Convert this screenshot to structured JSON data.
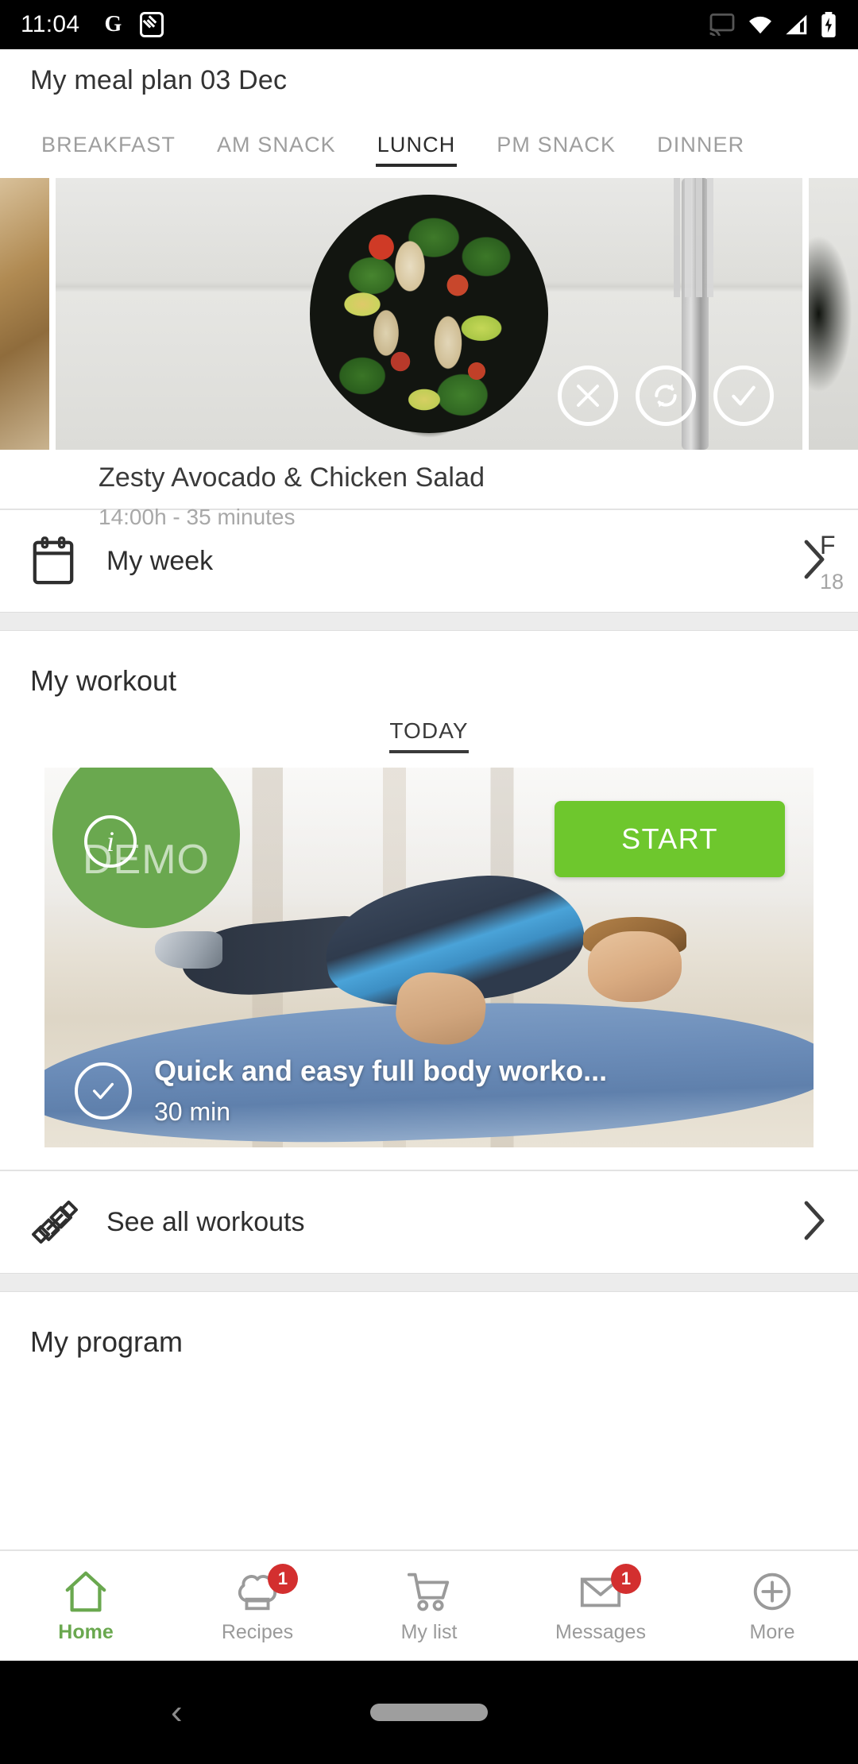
{
  "status_bar": {
    "time": "11:04",
    "left_icons": [
      "google-icon",
      "screenshot-edit-icon"
    ],
    "right_icons": [
      "cast-icon",
      "wifi-icon",
      "signal-icon",
      "battery-charging-icon"
    ]
  },
  "app_bar": {
    "title": "My meal plan 03 Dec"
  },
  "meal_tabs": {
    "items": [
      {
        "label": "BREAKFAST",
        "active": false
      },
      {
        "label": "AM SNACK",
        "active": false
      },
      {
        "label": "LUNCH",
        "active": true
      },
      {
        "label": "PM SNACK",
        "active": false
      },
      {
        "label": "DINNER",
        "active": false
      }
    ]
  },
  "meal_card": {
    "title": "Zesty Avocado & Chicken Salad",
    "subtitle": "14:00h - 35 minutes",
    "actions": [
      {
        "name": "dismiss-meal-button",
        "icon": "close-icon"
      },
      {
        "name": "swap-meal-button",
        "icon": "refresh-icon"
      },
      {
        "name": "accept-meal-button",
        "icon": "check-icon"
      }
    ],
    "next_card_peek": {
      "title": "F",
      "subtitle": "18"
    }
  },
  "my_week_row": {
    "label": "My week",
    "icon": "calendar-icon",
    "chevron": "chevron-right-icon"
  },
  "workout_section": {
    "title": "My workout",
    "today_tab": "TODAY",
    "card": {
      "demo_badge": "DEMO",
      "info_icon": "info-icon",
      "start_button": "START",
      "title": "Quick and easy full body worko...",
      "duration": "30 min",
      "completed_icon": "check-circle-icon"
    }
  },
  "see_all_workouts_row": {
    "label": "See all workouts",
    "icon": "dumbbell-icon",
    "chevron": "chevron-right-icon"
  },
  "program_section": {
    "title": "My program"
  },
  "bottom_nav": {
    "items": [
      {
        "label": "Home",
        "icon": "home-icon",
        "active": true,
        "badge": ""
      },
      {
        "label": "Recipes",
        "icon": "chef-hat-icon",
        "active": false,
        "badge": "1"
      },
      {
        "label": "My list",
        "icon": "cart-icon",
        "active": false,
        "badge": ""
      },
      {
        "label": "Messages",
        "icon": "envelope-icon",
        "active": false,
        "badge": "1"
      },
      {
        "label": "More",
        "icon": "plus-circle-icon",
        "active": false,
        "badge": ""
      }
    ]
  },
  "android_nav": {
    "back": "back-chevron-icon",
    "home": "home-pill-icon"
  },
  "colors": {
    "accent_green": "#6aa84f",
    "start_green": "#6ec72d",
    "badge_red": "#d32f2f",
    "text_dark": "#2e2e2e",
    "text_muted": "#9a9a9a"
  }
}
